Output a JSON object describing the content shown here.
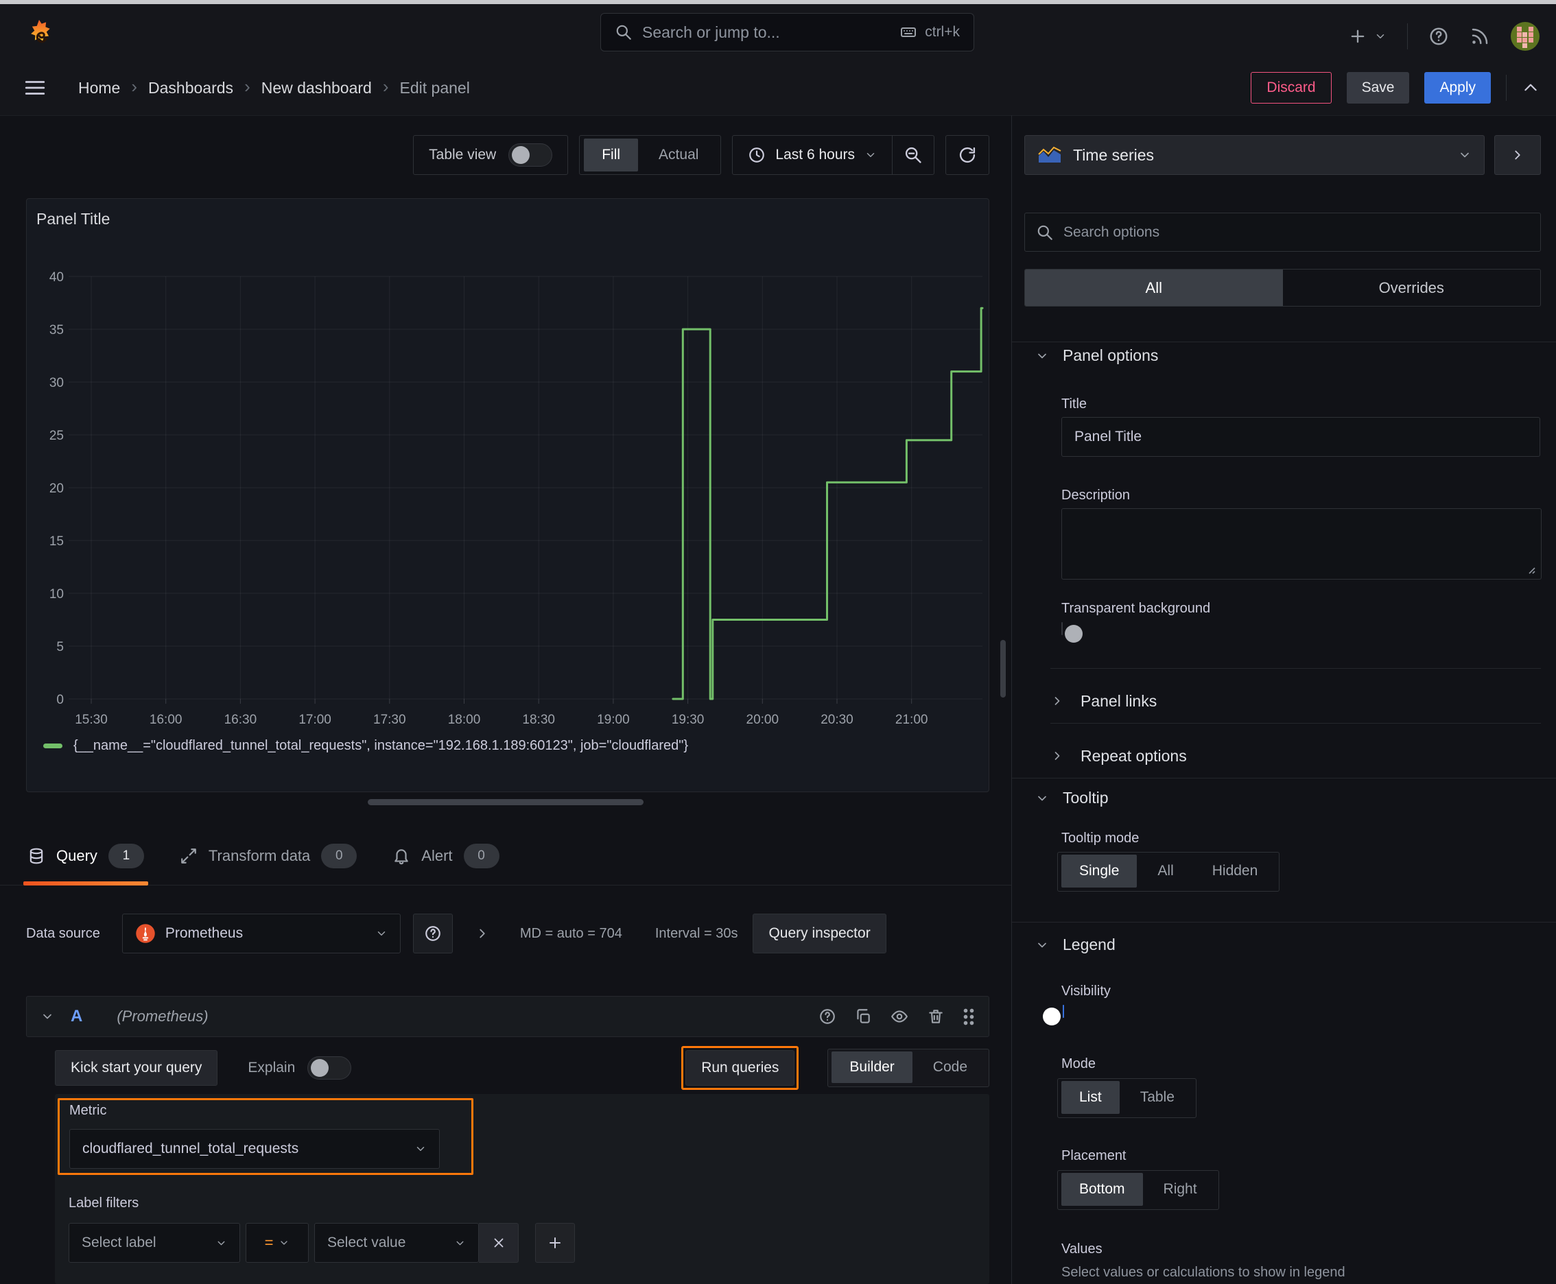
{
  "topnav": {
    "search_placeholder": "Search or jump to...",
    "shortcut": "ctrl+k"
  },
  "breadcrumb": {
    "items": [
      "Home",
      "Dashboards",
      "New dashboard",
      "Edit panel"
    ],
    "discard": "Discard",
    "save": "Save",
    "apply": "Apply"
  },
  "toolbar": {
    "table_view": "Table view",
    "fill": "Fill",
    "actual": "Actual",
    "time_range": "Last 6 hours"
  },
  "panel": {
    "title": "Panel Title"
  },
  "chart_data": {
    "type": "line",
    "line_style": "step-after",
    "title": "Panel Title",
    "series": [
      {
        "name": "{__name__=\"cloudflared_tunnel_total_requests\", instance=\"192.168.1.189:60123\", job=\"cloudflared\"}",
        "color": "#73bf69",
        "points": [
          {
            "t": "19:24",
            "v": 0
          },
          {
            "t": "19:28",
            "v": 35
          },
          {
            "t": "19:39",
            "v": 0
          },
          {
            "t": "19:40",
            "v": 7.5
          },
          {
            "t": "20:26",
            "v": 20.5
          },
          {
            "t": "20:58",
            "v": 24.5
          },
          {
            "t": "21:16",
            "v": 31
          },
          {
            "t": "21:28",
            "v": 37
          }
        ],
        "end_t": "21:29"
      }
    ],
    "x_ticks": [
      "15:30",
      "16:00",
      "16:30",
      "17:00",
      "17:30",
      "18:00",
      "18:30",
      "19:00",
      "19:30",
      "20:00",
      "20:30",
      "21:00"
    ],
    "y_ticks": [
      0,
      5,
      10,
      15,
      20,
      25,
      30,
      35,
      40
    ],
    "ylim": [
      0,
      40
    ],
    "x_range": [
      "15:21",
      "21:29"
    ],
    "grid": true,
    "legend_position": "bottom"
  },
  "tabs": {
    "query": "Query",
    "query_count": "1",
    "transform": "Transform data",
    "transform_count": "0",
    "alert": "Alert",
    "alert_count": "0"
  },
  "query_editor": {
    "data_source_label": "Data source",
    "data_source": "Prometheus",
    "stats": "MD = auto = 704",
    "interval": "Interval = 30s",
    "query_inspector": "Query inspector",
    "ref_id": "A",
    "ref_ds": "(Prometheus)",
    "kick_start": "Kick start your query",
    "explain": "Explain",
    "run_queries": "Run queries",
    "builder": "Builder",
    "code": "Code",
    "metric_label": "Metric",
    "metric_value": "cloudflared_tunnel_total_requests",
    "label_filters": "Label filters",
    "select_label": "Select label",
    "operator": "=",
    "select_value": "Select value"
  },
  "sidebar": {
    "viz": "Time series",
    "search_placeholder": "Search options",
    "tab_all": "All",
    "tab_overrides": "Overrides",
    "panel_options": {
      "header": "Panel options",
      "title_label": "Title",
      "title_value": "Panel Title",
      "description_label": "Description",
      "transparent_label": "Transparent background",
      "panel_links": "Panel links",
      "repeat_options": "Repeat options"
    },
    "tooltip": {
      "header": "Tooltip",
      "mode_label": "Tooltip mode",
      "modes": [
        "Single",
        "All",
        "Hidden"
      ]
    },
    "legend": {
      "header": "Legend",
      "visibility_label": "Visibility",
      "mode_label": "Mode",
      "modes": [
        "List",
        "Table"
      ],
      "placement_label": "Placement",
      "placements": [
        "Bottom",
        "Right"
      ],
      "values_label": "Values",
      "values_hint": "Select values or calculations to show in legend"
    }
  },
  "colors": {
    "accent_orange": "#ff780a",
    "series_green": "#73bf69",
    "primary_blue": "#3871dc",
    "danger_pink": "#f2537f",
    "prometheus_orange": "#e6522c"
  }
}
